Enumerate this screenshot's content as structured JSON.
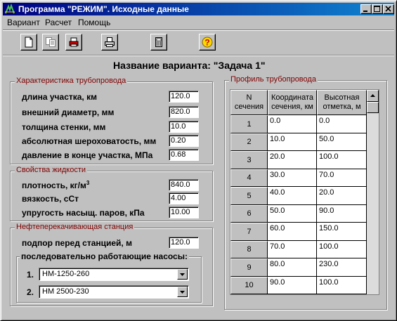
{
  "window": {
    "title": "Программа \"РЕЖИМ\". Исходные данные",
    "controls": [
      "minimize-icon",
      "maximize-icon",
      "close-icon"
    ]
  },
  "menu": {
    "items": [
      {
        "label": "Вариант"
      },
      {
        "label": "Расчет"
      },
      {
        "label": "Помощь"
      }
    ]
  },
  "toolbar": {
    "icons": [
      "new-file-icon",
      "copy-icon",
      "open-icon",
      "print-icon",
      "calculator-icon",
      "help-icon"
    ]
  },
  "variant": {
    "prefix": "Название варианта:",
    "name": "\"Задача 1\""
  },
  "pipeline": {
    "title": "Характеристика трубопровода",
    "fields": [
      {
        "label": "длина участка, км",
        "value": "120.0"
      },
      {
        "label": "внешний диаметр, мм",
        "value": "820.0"
      },
      {
        "label": "толщина стенки, мм",
        "value": "10.0"
      },
      {
        "label": "абсолютная шероховатость, мм",
        "value": "0.20"
      },
      {
        "label": "давление в конце участка, МПа",
        "value": "0.68"
      }
    ]
  },
  "liquid": {
    "title": "Свойства жидкости",
    "fields": [
      {
        "label": "плотность, кг/м",
        "sup": "3",
        "value": "840.0"
      },
      {
        "label": "вязкость, сСт",
        "value": "4.00"
      },
      {
        "label": "упругость насыщ. паров, кПа",
        "value": "10.00"
      }
    ]
  },
  "station": {
    "title": "Нефтеперекачивающая станция",
    "head_label": "подпор перед станцией, м",
    "head_value": "120.0",
    "pumps_label": "последовательно работающие насосы:",
    "pumps": [
      {
        "num": "1.",
        "value": "НМ-1250-260"
      },
      {
        "num": "2.",
        "value": "НМ 2500-230"
      }
    ]
  },
  "profile": {
    "title": "Профиль трубопровода",
    "headers": [
      "N сечения",
      "Координата сечения, км",
      "Высотная отметка, м"
    ],
    "rows": [
      {
        "n": "1",
        "x": "0.0",
        "h": "0.0"
      },
      {
        "n": "2",
        "x": "10.0",
        "h": "50.0"
      },
      {
        "n": "3",
        "x": "20.0",
        "h": "100.0"
      },
      {
        "n": "4",
        "x": "30.0",
        "h": "70.0"
      },
      {
        "n": "5",
        "x": "40.0",
        "h": "20.0"
      },
      {
        "n": "6",
        "x": "50.0",
        "h": "90.0"
      },
      {
        "n": "7",
        "x": "60.0",
        "h": "150.0"
      },
      {
        "n": "8",
        "x": "70.0",
        "h": "100.0"
      },
      {
        "n": "9",
        "x": "80.0",
        "h": "230.0"
      },
      {
        "n": "10",
        "x": "90.0",
        "h": "100.0"
      }
    ]
  }
}
